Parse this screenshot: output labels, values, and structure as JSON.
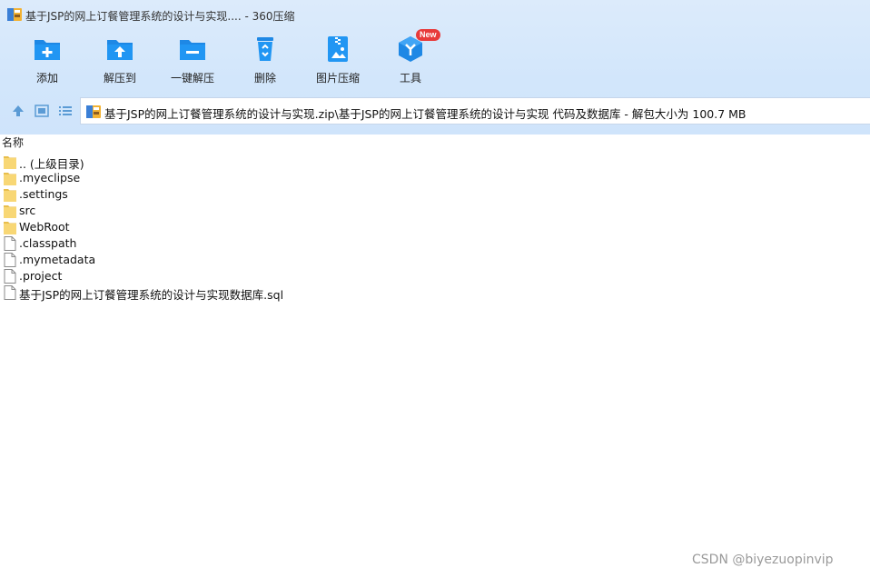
{
  "window": {
    "title": "基于JSP的网上订餐管理系统的设计与实现.... - 360压缩"
  },
  "toolbar": {
    "items": [
      {
        "label": "添加",
        "icon": "add-folder-icon"
      },
      {
        "label": "解压到",
        "icon": "extract-to-icon"
      },
      {
        "label": "一键解压",
        "icon": "one-click-extract-icon"
      },
      {
        "label": "删除",
        "icon": "recycle-bin-icon"
      },
      {
        "label": "图片压缩",
        "icon": "image-compress-icon"
      },
      {
        "label": "工具",
        "icon": "tools-cube-icon",
        "badge": "New"
      }
    ]
  },
  "nav": {
    "path": "基于JSP的网上订餐管理系统的设计与实现.zip\\基于JSP的网上订餐管理系统的设计与实现 代码及数据库 - 解包大小为 100.7 MB"
  },
  "list": {
    "column_name": "名称",
    "items": [
      {
        "name": ".. (上级目录)",
        "type": "folder"
      },
      {
        "name": ".myeclipse",
        "type": "folder"
      },
      {
        "name": ".settings",
        "type": "folder"
      },
      {
        "name": "src",
        "type": "folder"
      },
      {
        "name": "WebRoot",
        "type": "folder"
      },
      {
        "name": ".classpath",
        "type": "file"
      },
      {
        "name": ".mymetadata",
        "type": "file"
      },
      {
        "name": ".project",
        "type": "file"
      },
      {
        "name": "基于JSP的网上订餐管理系统的设计与实现数据库.sql",
        "type": "file"
      }
    ]
  },
  "watermark": "CSDN @biyezuopinvip",
  "colors": {
    "accent": "#1e88e5",
    "folder": "#f8d775",
    "toolbar_bg": "#d4e7fb"
  }
}
